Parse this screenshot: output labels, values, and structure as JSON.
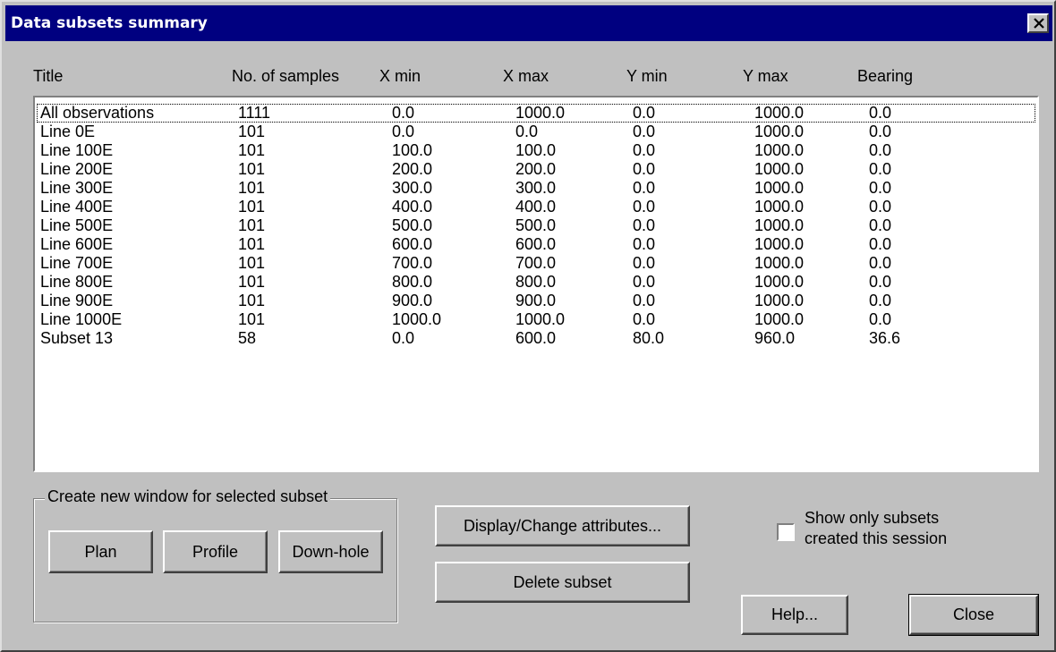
{
  "window": {
    "title": "Data subsets summary",
    "close_glyph": "close-icon"
  },
  "table": {
    "columns": [
      "Title",
      "No. of samples",
      "X min",
      "X max",
      "Y min",
      "Y max",
      "Bearing"
    ],
    "rows": [
      [
        "All observations",
        "1111",
        "0.0",
        "1000.0",
        "0.0",
        "1000.0",
        "0.0"
      ],
      [
        "Line 0E",
        "101",
        "0.0",
        "0.0",
        "0.0",
        "1000.0",
        "0.0"
      ],
      [
        "Line 100E",
        "101",
        "100.0",
        "100.0",
        "0.0",
        "1000.0",
        "0.0"
      ],
      [
        "Line 200E",
        "101",
        "200.0",
        "200.0",
        "0.0",
        "1000.0",
        "0.0"
      ],
      [
        "Line 300E",
        "101",
        "300.0",
        "300.0",
        "0.0",
        "1000.0",
        "0.0"
      ],
      [
        "Line 400E",
        "101",
        "400.0",
        "400.0",
        "0.0",
        "1000.0",
        "0.0"
      ],
      [
        "Line 500E",
        "101",
        "500.0",
        "500.0",
        "0.0",
        "1000.0",
        "0.0"
      ],
      [
        "Line 600E",
        "101",
        "600.0",
        "600.0",
        "0.0",
        "1000.0",
        "0.0"
      ],
      [
        "Line 700E",
        "101",
        "700.0",
        "700.0",
        "0.0",
        "1000.0",
        "0.0"
      ],
      [
        "Line 800E",
        "101",
        "800.0",
        "800.0",
        "0.0",
        "1000.0",
        "0.0"
      ],
      [
        "Line 900E",
        "101",
        "900.0",
        "900.0",
        "0.0",
        "1000.0",
        "0.0"
      ],
      [
        "Line 1000E",
        "101",
        "1000.0",
        "1000.0",
        "0.0",
        "1000.0",
        "0.0"
      ],
      [
        "Subset 13",
        "58",
        "0.0",
        "600.0",
        "80.0",
        "960.0",
        "36.6"
      ]
    ]
  },
  "create_window_group": {
    "legend": "Create new window for selected subset",
    "plan_label": "Plan",
    "profile_label": "Profile",
    "downhole_label": "Down-hole"
  },
  "actions": {
    "display_change_label": "Display/Change attributes...",
    "delete_label": "Delete subset",
    "help_label": "Help...",
    "close_label": "Close"
  },
  "session_filter": {
    "line1": "Show only subsets",
    "line2": "created this session",
    "checked": false
  },
  "colors": {
    "titlebar": "#000080",
    "face": "#c0c0c0",
    "list_bg": "#ffffff"
  }
}
